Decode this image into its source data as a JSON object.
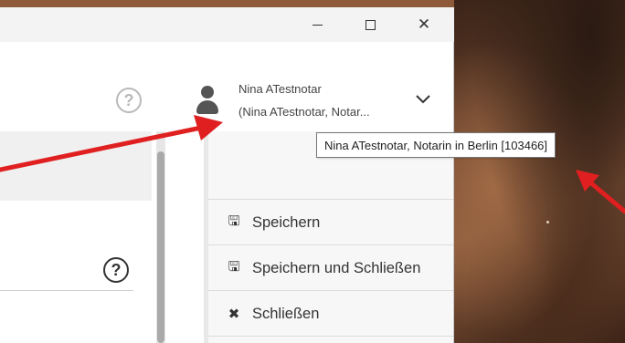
{
  "window": {
    "minimize_glyph": "–",
    "maximize_glyph": "☐",
    "close_glyph": "✕"
  },
  "header": {
    "help_glyph": "?",
    "user": {
      "name": "Nina ATestnotar",
      "role_truncated": "(Nina ATestnotar, Notar...",
      "icon": "user-icon",
      "dropdown_icon": "chevron-down-icon"
    }
  },
  "tooltip": {
    "text": "Nina ATestnotar, Notarin in Berlin [103466]"
  },
  "form": {
    "help_glyph": "?"
  },
  "actions": {
    "items": [
      {
        "label": "Speichern",
        "icon": "floppy-disk-icon",
        "glyph": "🖫"
      },
      {
        "label": "Speichern und Schließen",
        "icon": "floppy-disk-icon",
        "glyph": "🖫"
      },
      {
        "label": "Schließen",
        "icon": "close-icon",
        "glyph": "✖"
      }
    ]
  },
  "colors": {
    "annotation_arrow": "#e02020",
    "title_bar": "#f3f3f3",
    "panel_bg": "#f7f7f7",
    "text": "#333333"
  }
}
